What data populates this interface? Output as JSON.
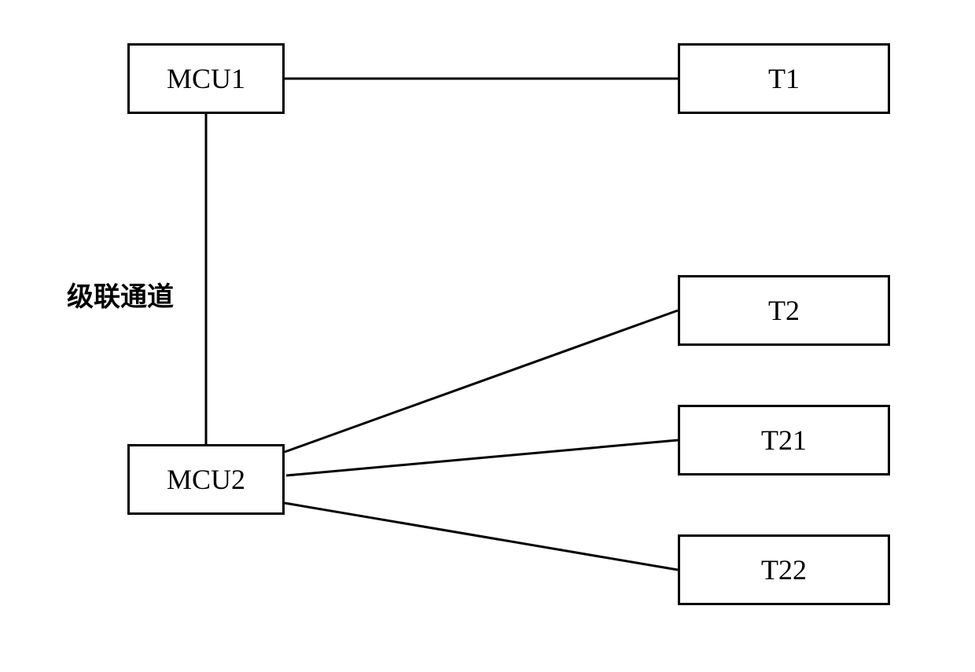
{
  "nodes": {
    "mcu1": "MCU1",
    "mcu2": "MCU2",
    "t1": "T1",
    "t2": "T2",
    "t21": "T21",
    "t22": "T22"
  },
  "edge_label": "级联通道"
}
